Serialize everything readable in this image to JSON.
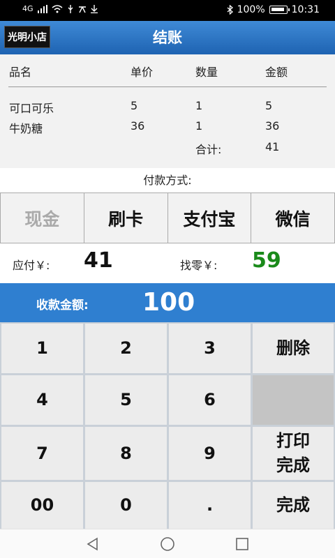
{
  "statusbar": {
    "left_text": "4G",
    "battery": "100%",
    "time": "10:31"
  },
  "header": {
    "shop_name": "光明小店",
    "title": "结账"
  },
  "order": {
    "columns": [
      "品名",
      "单价",
      "数量",
      "金额"
    ],
    "items": [
      [
        "可口可乐",
        "5",
        "1",
        "5"
      ],
      [
        "牛奶糖",
        "36",
        "1",
        "36"
      ]
    ],
    "total_label": "合计:",
    "total_value": "41"
  },
  "payment": {
    "label": "付款方式:",
    "methods": [
      "现金",
      "刷卡",
      "支付宝",
      "微信"
    ],
    "selected": "现金"
  },
  "amounts": {
    "due_label": "应付￥:",
    "due_value": "41",
    "change_label": "找零￥:",
    "change_value": "59"
  },
  "received": {
    "label": "收款金额:",
    "value": "100"
  },
  "keypad": {
    "keys": [
      "1",
      "2",
      "3",
      "删除",
      "4",
      "5",
      "6",
      "",
      "7",
      "8",
      "9",
      "打印\n完成",
      "00",
      "0",
      ".",
      "完成"
    ]
  },
  "colors": {
    "header_blue": "#2f7fd0",
    "change_green": "#1a8a1a",
    "selected_gray": "#aaaaaa"
  }
}
